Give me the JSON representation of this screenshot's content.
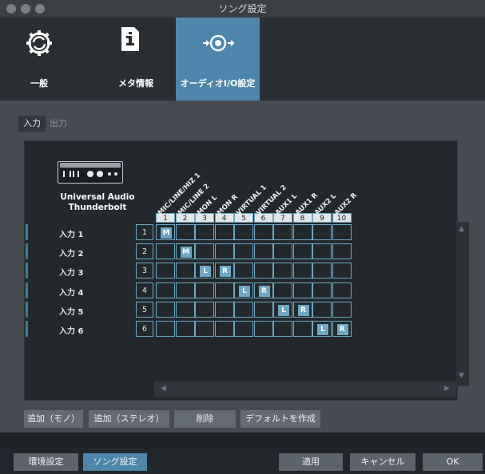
{
  "window": {
    "title": "ソング設定"
  },
  "toolbar": {
    "items": [
      {
        "label": "一般",
        "icon": "gear-icon"
      },
      {
        "label": "メタ情報",
        "icon": "document-info-icon"
      },
      {
        "label": "オーディオI/O設定",
        "icon": "audio-io-icon",
        "active": true
      }
    ]
  },
  "tabs": {
    "input": "入力",
    "output": "出力"
  },
  "device": {
    "name_line1": "Universal Audio",
    "name_line2": "Thunderbolt"
  },
  "columns": {
    "labels": [
      "MIC/LINE/HIZ 1",
      "MIC/LINE 2",
      "MON L",
      "MON R",
      "VIRTUAL 1",
      "VIRTUAL 2",
      "AUX1 L",
      "AUX1 R",
      "AUX2 L",
      "AUX2 R"
    ],
    "numbers": [
      "1",
      "2",
      "3",
      "4",
      "5",
      "6",
      "7",
      "8",
      "9",
      "10"
    ]
  },
  "rows": [
    {
      "label": "入力 1",
      "number": "1",
      "chips": {
        "0": "M"
      }
    },
    {
      "label": "入力 2",
      "number": "2",
      "chips": {
        "1": "M"
      }
    },
    {
      "label": "入力 3",
      "number": "3",
      "chips": {
        "2": "L",
        "3": "R"
      }
    },
    {
      "label": "入力 4",
      "number": "4",
      "chips": {
        "4": "L",
        "5": "R"
      }
    },
    {
      "label": "入力 5",
      "number": "5",
      "chips": {
        "6": "L",
        "7": "R"
      }
    },
    {
      "label": "入力 6",
      "number": "6",
      "chips": {
        "8": "L",
        "9": "R"
      }
    }
  ],
  "actions": {
    "add_mono": "追加（モノ）",
    "add_stereo": "追加（ステレオ）",
    "delete": "削除",
    "make_default": "デフォルトを作成"
  },
  "footer": {
    "preferences": "環境設定",
    "song_settings": "ソング設定",
    "apply": "適用",
    "cancel": "キャンセル",
    "ok": "OK"
  },
  "colors": {
    "accent": "#4d86ad",
    "grid": "#6aa8c5"
  }
}
